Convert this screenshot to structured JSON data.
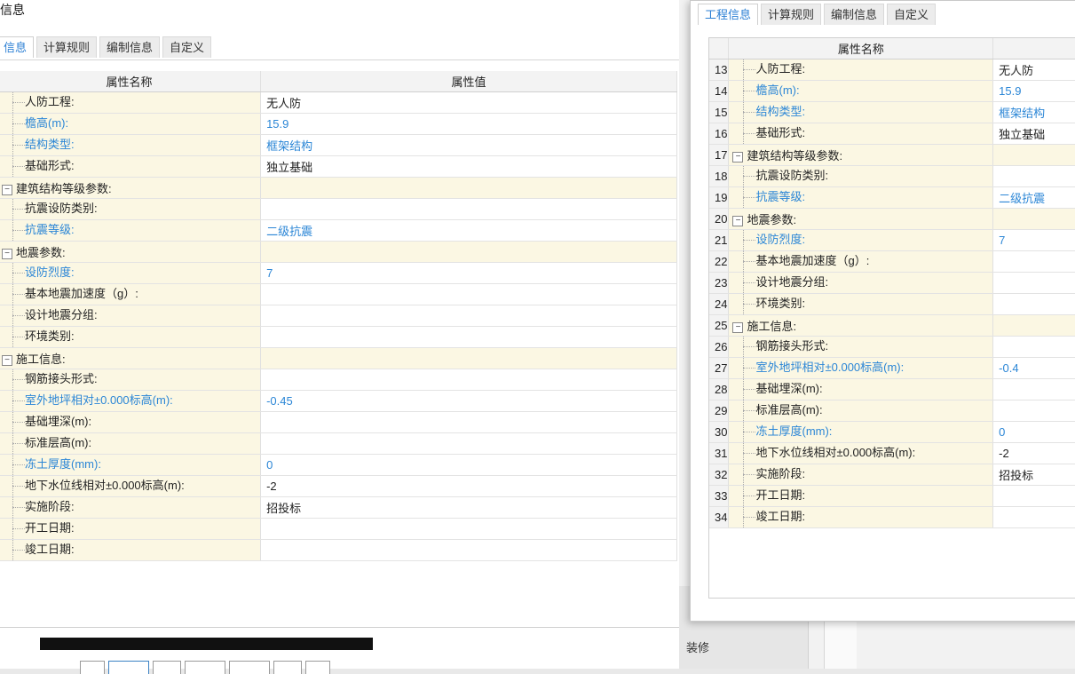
{
  "left_panel": {
    "title": "信息",
    "tabs": [
      "信息",
      "计算规则",
      "编制信息",
      "自定义"
    ],
    "active_tab": 0,
    "headers": {
      "name": "属性名称",
      "value": "属性值"
    },
    "rows": [
      {
        "name": "人防工程:",
        "value": "无人防",
        "blue": false,
        "group": false
      },
      {
        "name": "檐高(m):",
        "value": "15.9",
        "blue": true,
        "group": false
      },
      {
        "name": "结构类型:",
        "value": "框架结构",
        "blue": true,
        "group": false
      },
      {
        "name": "基础形式:",
        "value": "独立基础",
        "blue": false,
        "group": false
      },
      {
        "name": "建筑结构等级参数:",
        "value": "",
        "blue": false,
        "group": true
      },
      {
        "name": "抗震设防类别:",
        "value": "",
        "blue": false,
        "group": false
      },
      {
        "name": "抗震等级:",
        "value": "二级抗震",
        "blue": true,
        "group": false
      },
      {
        "name": "地震参数:",
        "value": "",
        "blue": false,
        "group": true
      },
      {
        "name": "设防烈度:",
        "value": "7",
        "blue": true,
        "group": false
      },
      {
        "name": "基本地震加速度（g）:",
        "value": "",
        "blue": false,
        "group": false
      },
      {
        "name": "设计地震分组:",
        "value": "",
        "blue": false,
        "group": false
      },
      {
        "name": "环境类别:",
        "value": "",
        "blue": false,
        "group": false
      },
      {
        "name": "施工信息:",
        "value": "",
        "blue": false,
        "group": true
      },
      {
        "name": "钢筋接头形式:",
        "value": "",
        "blue": false,
        "group": false
      },
      {
        "name": "室外地坪相对±0.000标高(m):",
        "value": "-0.45",
        "blue": true,
        "group": false
      },
      {
        "name": "基础埋深(m):",
        "value": "",
        "blue": false,
        "group": false
      },
      {
        "name": "标准层高(m):",
        "value": "",
        "blue": false,
        "group": false
      },
      {
        "name": "冻土厚度(mm):",
        "value": "0",
        "blue": true,
        "group": false
      },
      {
        "name": "地下水位线相对±0.000标高(m):",
        "value": "-2",
        "blue": false,
        "group": false
      },
      {
        "name": "实施阶段:",
        "value": "招投标",
        "blue": false,
        "group": false
      },
      {
        "name": "开工日期:",
        "value": "",
        "blue": false,
        "group": false
      },
      {
        "name": "竣工日期:",
        "value": "",
        "blue": false,
        "group": false
      }
    ]
  },
  "right_panel": {
    "tabs": [
      "工程信息",
      "计算规则",
      "编制信息",
      "自定义"
    ],
    "active_tab": 0,
    "headers": {
      "name": "属性名称"
    },
    "rows": [
      {
        "num": "13",
        "name": "人防工程:",
        "value": "无人防",
        "blue": false,
        "group": false
      },
      {
        "num": "14",
        "name": "檐高(m):",
        "value": "15.9",
        "blue": true,
        "group": false
      },
      {
        "num": "15",
        "name": "结构类型:",
        "value": "框架结构",
        "blue": true,
        "group": false
      },
      {
        "num": "16",
        "name": "基础形式:",
        "value": "独立基础",
        "blue": false,
        "group": false
      },
      {
        "num": "17",
        "name": "建筑结构等级参数:",
        "value": "",
        "blue": false,
        "group": true
      },
      {
        "num": "18",
        "name": "抗震设防类别:",
        "value": "",
        "blue": false,
        "group": false
      },
      {
        "num": "19",
        "name": "抗震等级:",
        "value": "二级抗震",
        "blue": true,
        "group": false
      },
      {
        "num": "20",
        "name": "地震参数:",
        "value": "",
        "blue": false,
        "group": true
      },
      {
        "num": "21",
        "name": "设防烈度:",
        "value": "7",
        "blue": true,
        "group": false
      },
      {
        "num": "22",
        "name": "基本地震加速度（g）:",
        "value": "",
        "blue": false,
        "group": false
      },
      {
        "num": "23",
        "name": "设计地震分组:",
        "value": "",
        "blue": false,
        "group": false
      },
      {
        "num": "24",
        "name": "环境类别:",
        "value": "",
        "blue": false,
        "group": false
      },
      {
        "num": "25",
        "name": "施工信息:",
        "value": "",
        "blue": false,
        "group": true
      },
      {
        "num": "26",
        "name": "钢筋接头形式:",
        "value": "",
        "blue": false,
        "group": false
      },
      {
        "num": "27",
        "name": "室外地坪相对±0.000标高(m):",
        "value": "-0.4",
        "blue": true,
        "group": false
      },
      {
        "num": "28",
        "name": "基础埋深(m):",
        "value": "",
        "blue": false,
        "group": false
      },
      {
        "num": "29",
        "name": "标准层高(m):",
        "value": "",
        "blue": false,
        "group": false
      },
      {
        "num": "30",
        "name": "冻土厚度(mm):",
        "value": "0",
        "blue": true,
        "group": false
      },
      {
        "num": "31",
        "name": "地下水位线相对±0.000标高(m):",
        "value": "-2",
        "blue": false,
        "group": false
      },
      {
        "num": "32",
        "name": "实施阶段:",
        "value": "招投标",
        "blue": false,
        "group": false
      },
      {
        "num": "33",
        "name": "开工日期:",
        "value": "",
        "blue": false,
        "group": false
      },
      {
        "num": "34",
        "name": "竣工日期:",
        "value": "",
        "blue": false,
        "group": false
      }
    ]
  },
  "background": {
    "sidebar_items": [
      "装修"
    ]
  },
  "colors": {
    "accent": "#2b86d6",
    "name_cell_bg": "#fbf7e3"
  }
}
